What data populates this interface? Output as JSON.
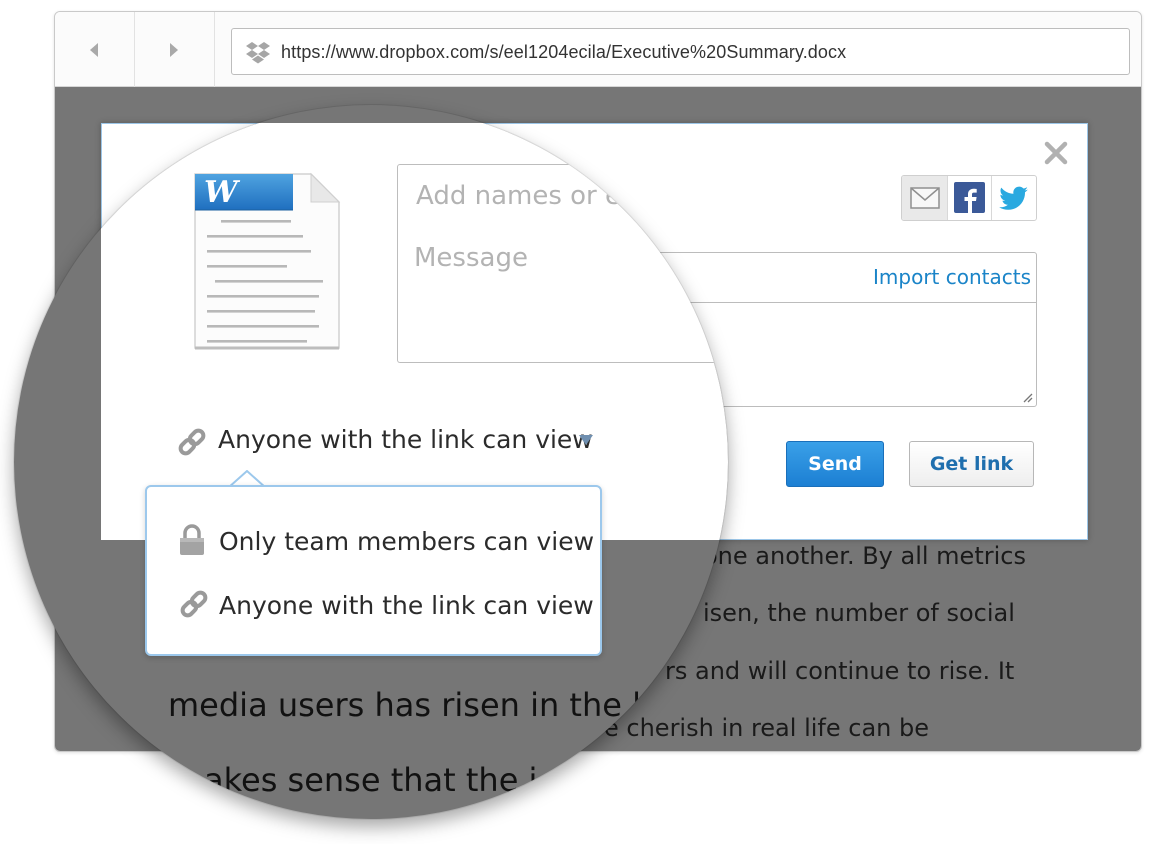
{
  "browser": {
    "url": "https://www.dropbox.com/s/eel1204ecila/Executive%20Summary.docx",
    "back_icon": "back-arrow-icon",
    "forward_icon": "forward-arrow-icon",
    "site_icon": "dropbox-icon"
  },
  "document": {
    "lines_right": [
      "one another. By all metrics",
      "isen, the number of social",
      "rs and will continue to rise. It",
      "e cherish in real life can be"
    ],
    "lines_magnified": [
      "media users has risen in the l",
      "akes sense that the i"
    ]
  },
  "dialog": {
    "file_icon": "word-document-icon",
    "file_badge": "W",
    "recipients_placeholder": "Add names or emails",
    "message_placeholder": "Message",
    "import_contacts": "Import contacts",
    "share_options": [
      "email-share-icon",
      "facebook-icon",
      "twitter-icon"
    ],
    "permission": "Anyone with the link can view",
    "send_label": "Send",
    "get_link_label": "Get link",
    "close_icon": "close-icon"
  },
  "permission_menu": {
    "items": [
      {
        "label": "Only team members can view",
        "icon": "lock-icon"
      },
      {
        "label": "Anyone with the link can view",
        "icon": "link-icon"
      }
    ]
  },
  "colors": {
    "accent_blue": "#1a84c8",
    "send_button": "#2a8edc",
    "menu_border": "#9cc8ec",
    "backdrop": "#767676"
  }
}
